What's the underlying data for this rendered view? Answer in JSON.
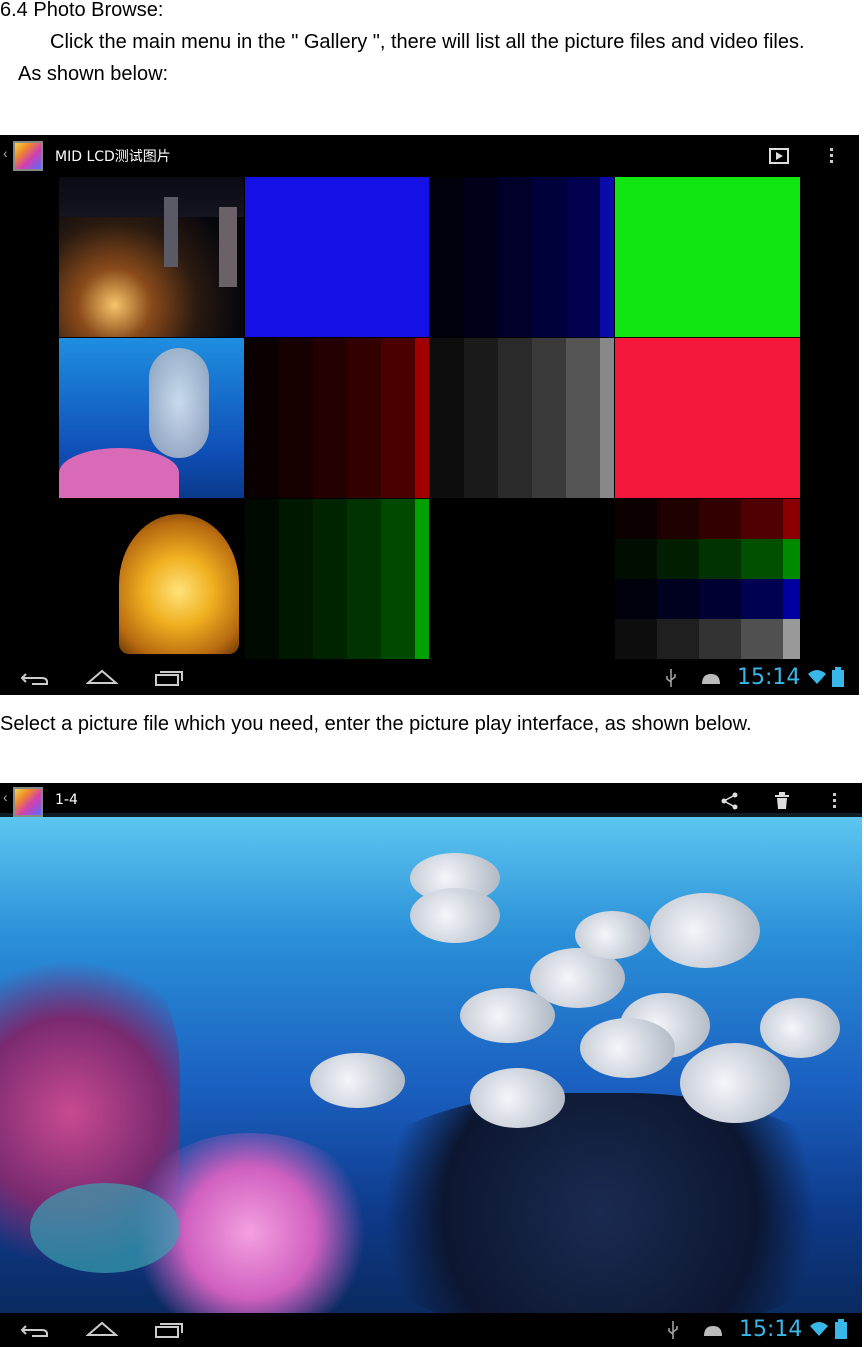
{
  "doc": {
    "heading": "6.4 Photo Browse:",
    "para1": "Click the main menu in the \" Gallery \", there will list all the picture files and video files.",
    "para2": "As shown below:",
    "para3": "Select a picture file which you need, enter the picture play interface, as shown below."
  },
  "gallery": {
    "album_title": "MID LCD测试图片",
    "caret_glyph": "‹",
    "slideshow_icon": "play-slideshow-icon",
    "menu_icon": "overflow-menu-icon",
    "time": "15:14"
  },
  "viewer": {
    "photo_title": "1-4",
    "caret_glyph": "‹",
    "share_icon": "share-icon",
    "delete_icon": "trash-icon",
    "menu_icon": "overflow-menu-icon",
    "time": "15:14"
  },
  "colors": {
    "clock": "#39b7e8",
    "blue_tile": "#1410e6",
    "green_tile": "#12e612",
    "red_tile": "#f5163c"
  }
}
